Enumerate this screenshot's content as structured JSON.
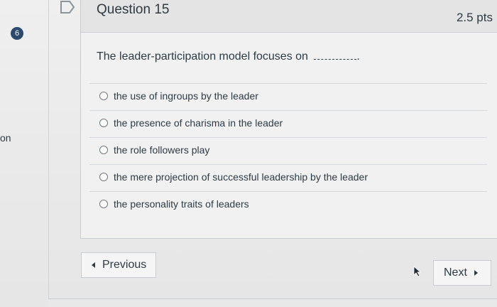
{
  "sidebar": {
    "question_badge": "6",
    "truncated_label": "on"
  },
  "question": {
    "title": "Question 15",
    "points": "2.5 pts",
    "text": "The leader-participation model focuses on",
    "text_suffix": ".",
    "answers": [
      {
        "label": "the use of ingroups by the leader",
        "selected": false
      },
      {
        "label": "the presence of charisma in the leader",
        "selected": false
      },
      {
        "label": "the role followers play",
        "selected": false
      },
      {
        "label": "the mere projection of successful leadership by the leader",
        "selected": false
      },
      {
        "label": "the personality traits of leaders",
        "selected": false
      }
    ]
  },
  "navigation": {
    "previous_label": "Previous",
    "next_label": "Next"
  },
  "icons": {
    "flag": "flag-icon",
    "cursor": "mouse-cursor-icon"
  },
  "colors": {
    "badge": "#2c4a6e",
    "text": "#2d3b45",
    "border": "#c7cdd1"
  }
}
